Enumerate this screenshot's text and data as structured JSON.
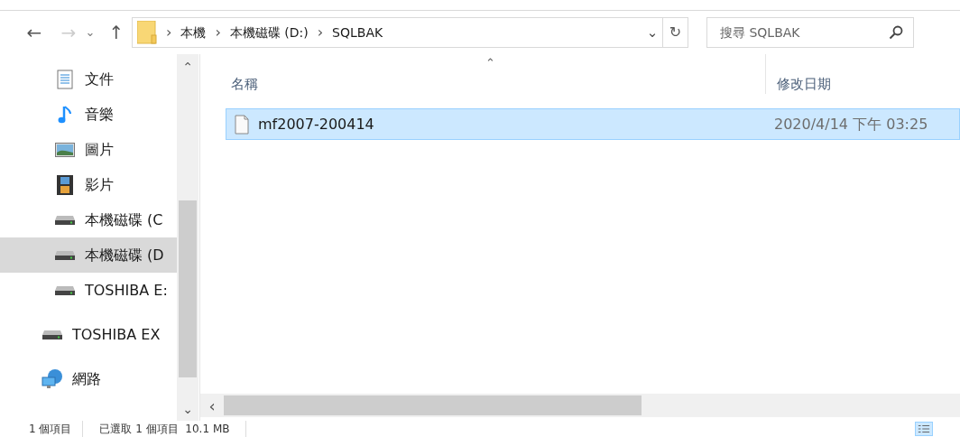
{
  "toolbar": {
    "back": "←",
    "forward": "→",
    "recent": "⌄",
    "up": "↑"
  },
  "address": {
    "crumbs": [
      "本機",
      "本機磁碟 (D:)",
      "SQLBAK"
    ],
    "separator": "›",
    "dropdown": "⌄",
    "refresh": "↻"
  },
  "search": {
    "placeholder": "搜尋 SQLBAK"
  },
  "nav_groups": [
    {
      "nested": true,
      "items": [
        {
          "label": "文件",
          "kind": "documents",
          "selected": false
        },
        {
          "label": "音樂",
          "kind": "music",
          "selected": false
        },
        {
          "label": "圖片",
          "kind": "pictures",
          "selected": false
        },
        {
          "label": "影片",
          "kind": "videos",
          "selected": false
        },
        {
          "label": "本機磁碟 (C",
          "kind": "drive",
          "selected": false
        },
        {
          "label": "本機磁碟 (D",
          "kind": "drive",
          "selected": true
        },
        {
          "label": "TOSHIBA E:",
          "kind": "drive",
          "selected": false
        }
      ]
    },
    {
      "nested": false,
      "items": [
        {
          "label": "TOSHIBA EX",
          "kind": "drive",
          "selected": false
        }
      ]
    },
    {
      "nested": false,
      "items": [
        {
          "label": "網路",
          "kind": "network",
          "selected": false
        }
      ]
    }
  ],
  "nav_scroll": {
    "up": "⌃",
    "down": "⌄"
  },
  "table": {
    "columns": [
      "名稱",
      "修改日期"
    ],
    "sort_mark": "⌃",
    "rows": [
      {
        "name": "mf2007-200414",
        "modified": "2020/4/14 下午 03:25",
        "selected": true
      }
    ]
  },
  "hscroll": {
    "left": "‹"
  },
  "status_bar": [
    "1 個項目",
    "已選取 1 個項目  10.1 MB"
  ]
}
